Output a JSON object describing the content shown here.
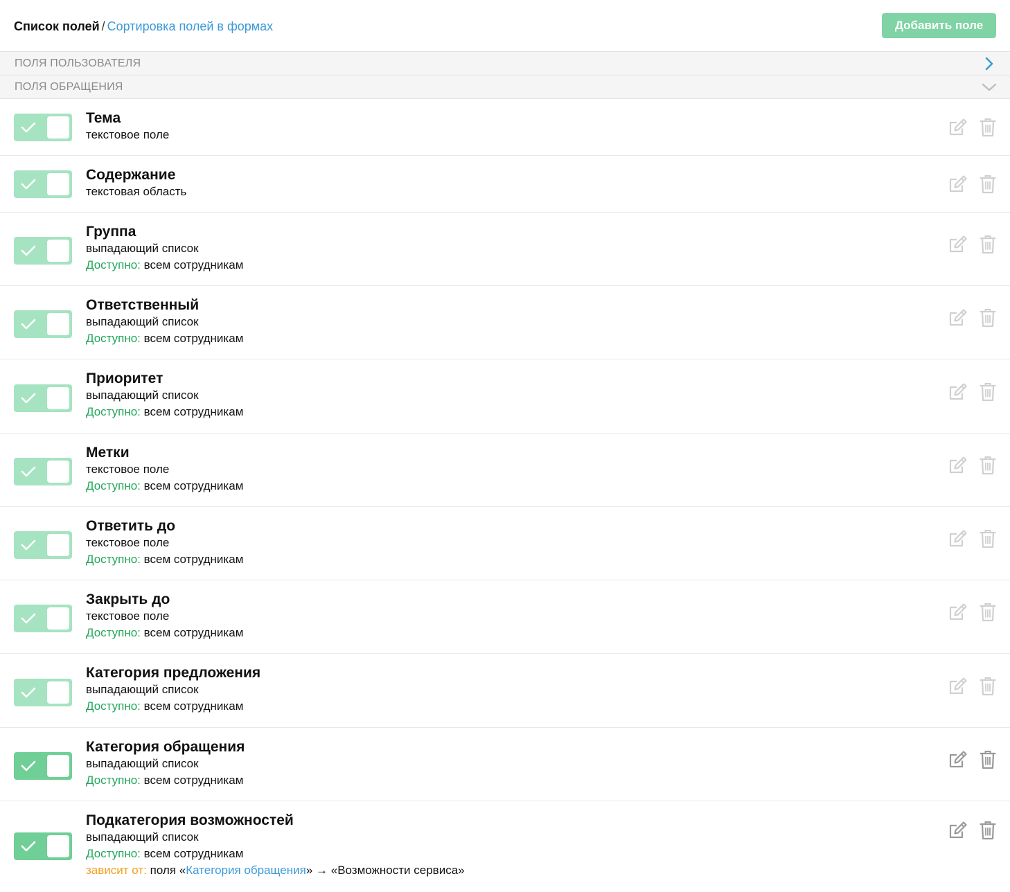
{
  "header": {
    "breadcrumb_current": "Список полей",
    "breadcrumb_separator": "/",
    "breadcrumb_link": "Сортировка полей в формах",
    "add_button": "Добавить поле",
    "add_button_color": "#7fd3a4"
  },
  "sections": [
    {
      "title": "ПОЛЯ ПОЛЬЗОВАТЕЛЯ",
      "state": "collapsed",
      "icon": "chevron-right-icon"
    },
    {
      "title": "ПОЛЯ ОБРАЩЕНИЯ",
      "state": "expanded",
      "icon": "chevron-down-icon"
    }
  ],
  "fields": [
    {
      "name": "Тема",
      "type": "текстовое поле",
      "enabled": true,
      "locked": true
    },
    {
      "name": "Содержание",
      "type": "текстовая область",
      "enabled": true,
      "locked": true
    },
    {
      "name": "Группа",
      "type": "выпадающий список",
      "access_label": "Доступно:",
      "access_value": "всем сотрудникам",
      "enabled": true,
      "locked": true
    },
    {
      "name": "Ответственный",
      "type": "выпадающий список",
      "access_label": "Доступно:",
      "access_value": "всем сотрудникам",
      "enabled": true,
      "locked": true
    },
    {
      "name": "Приоритет",
      "type": "выпадающий список",
      "access_label": "Доступно:",
      "access_value": "всем сотрудникам",
      "enabled": true,
      "locked": true
    },
    {
      "name": "Метки",
      "type": "текстовое поле",
      "access_label": "Доступно:",
      "access_value": "всем сотрудникам",
      "enabled": true,
      "locked": true
    },
    {
      "name": "Ответить до",
      "type": "текстовое поле",
      "access_label": "Доступно:",
      "access_value": "всем сотрудникам",
      "enabled": true,
      "locked": true
    },
    {
      "name": "Закрыть до",
      "type": "текстовое поле",
      "access_label": "Доступно:",
      "access_value": "всем сотрудникам",
      "enabled": true,
      "locked": true
    },
    {
      "name": "Категория предложения",
      "type": "выпадающий список",
      "access_label": "Доступно:",
      "access_value": "всем сотрудникам",
      "enabled": true,
      "locked": true
    },
    {
      "name": "Категория обращения",
      "type": "выпадающий список",
      "access_label": "Доступно:",
      "access_value": "всем сотрудникам",
      "enabled": true,
      "locked": false
    },
    {
      "name": "Подкатегория возможностей",
      "type": "выпадающий список",
      "access_label": "Доступно:",
      "access_value": "всем сотрудникам",
      "enabled": true,
      "locked": false,
      "depends_label": "зависит от:",
      "depends_prefix": "поля «",
      "depends_field": "Категория обращения",
      "depends_suffix": "» → «Возможности сервиса»"
    }
  ],
  "colors": {
    "toggle_locked": "#a6e3c1",
    "toggle_active": "#6fcf97",
    "access_label": "#22a65a",
    "depends_label": "#f0a020",
    "link": "#3a9ad9",
    "icon_locked": "#d0d0d0",
    "icon_active": "#999999"
  }
}
